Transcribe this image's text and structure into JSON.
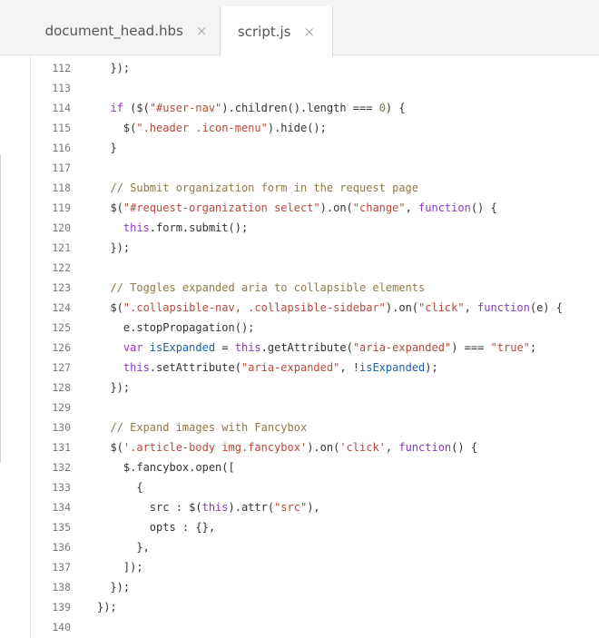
{
  "tabs": [
    {
      "label": "document_head.hbs",
      "close": "×",
      "active": false
    },
    {
      "label": "script.js",
      "close": "×",
      "active": true
    }
  ],
  "colors": {
    "keyword": "#8a3ab9",
    "string": "#b14a3a",
    "comment": "#8f7a4a",
    "number": "#6a8a3a",
    "variable": "#1f5fa0",
    "plain": "#333333"
  },
  "lines": [
    {
      "n": "112",
      "tokens": [
        {
          "t": "p",
          "s": "  });"
        }
      ]
    },
    {
      "n": "113",
      "tokens": []
    },
    {
      "n": "114",
      "tokens": [
        {
          "t": "kw",
          "s": "  if"
        },
        {
          "t": "p",
          "s": " ($("
        },
        {
          "t": "str",
          "s": "\"#user-nav\""
        },
        {
          "t": "p",
          "s": ").children().length === "
        },
        {
          "t": "num",
          "s": "0"
        },
        {
          "t": "p",
          "s": ") {"
        }
      ]
    },
    {
      "n": "115",
      "tokens": [
        {
          "t": "p",
          "s": "    $("
        },
        {
          "t": "str",
          "s": "\".header .icon-menu\""
        },
        {
          "t": "p",
          "s": ").hide();"
        }
      ]
    },
    {
      "n": "116",
      "tokens": [
        {
          "t": "p",
          "s": "  }"
        }
      ]
    },
    {
      "n": "117",
      "tokens": []
    },
    {
      "n": "118",
      "tokens": [
        {
          "t": "cm",
          "s": "  // Submit organization form in the request page"
        }
      ]
    },
    {
      "n": "119",
      "tokens": [
        {
          "t": "p",
          "s": "  $("
        },
        {
          "t": "str",
          "s": "\"#request-organization select\""
        },
        {
          "t": "p",
          "s": ").on("
        },
        {
          "t": "str",
          "s": "\"change\""
        },
        {
          "t": "p",
          "s": ", "
        },
        {
          "t": "kw",
          "s": "function"
        },
        {
          "t": "p",
          "s": "() {"
        }
      ]
    },
    {
      "n": "120",
      "tokens": [
        {
          "t": "kw",
          "s": "    this"
        },
        {
          "t": "p",
          "s": ".form.submit();"
        }
      ]
    },
    {
      "n": "121",
      "tokens": [
        {
          "t": "p",
          "s": "  });"
        }
      ]
    },
    {
      "n": "122",
      "tokens": []
    },
    {
      "n": "123",
      "tokens": [
        {
          "t": "cm",
          "s": "  // Toggles expanded aria to collapsible elements"
        }
      ]
    },
    {
      "n": "124",
      "tokens": [
        {
          "t": "p",
          "s": "  $("
        },
        {
          "t": "str",
          "s": "\".collapsible-nav, .collapsible-sidebar\""
        },
        {
          "t": "p",
          "s": ").on("
        },
        {
          "t": "str",
          "s": "\"click\""
        },
        {
          "t": "p",
          "s": ", "
        },
        {
          "t": "kw",
          "s": "function"
        },
        {
          "t": "p",
          "s": "(e) {"
        }
      ]
    },
    {
      "n": "125",
      "tokens": [
        {
          "t": "p",
          "s": "    e.stopPropagation();"
        }
      ]
    },
    {
      "n": "126",
      "tokens": [
        {
          "t": "kw",
          "s": "    var"
        },
        {
          "t": "p",
          "s": " "
        },
        {
          "t": "var",
          "s": "isExpanded"
        },
        {
          "t": "p",
          "s": " = "
        },
        {
          "t": "kw",
          "s": "this"
        },
        {
          "t": "p",
          "s": ".getAttribute("
        },
        {
          "t": "str",
          "s": "\"aria-expanded\""
        },
        {
          "t": "p",
          "s": ") === "
        },
        {
          "t": "str",
          "s": "\"true\""
        },
        {
          "t": "p",
          "s": ";"
        }
      ]
    },
    {
      "n": "127",
      "tokens": [
        {
          "t": "kw",
          "s": "    this"
        },
        {
          "t": "p",
          "s": ".setAttribute("
        },
        {
          "t": "str",
          "s": "\"aria-expanded\""
        },
        {
          "t": "p",
          "s": ", !"
        },
        {
          "t": "var",
          "s": "isExpanded"
        },
        {
          "t": "p",
          "s": ");"
        }
      ]
    },
    {
      "n": "128",
      "tokens": [
        {
          "t": "p",
          "s": "  });"
        }
      ]
    },
    {
      "n": "129",
      "tokens": []
    },
    {
      "n": "130",
      "tokens": [
        {
          "t": "cm",
          "s": "  // Expand images with Fancybox"
        }
      ]
    },
    {
      "n": "131",
      "tokens": [
        {
          "t": "p",
          "s": "  $("
        },
        {
          "t": "str",
          "s": "'.article-body img.fancybox'"
        },
        {
          "t": "p",
          "s": ").on("
        },
        {
          "t": "str",
          "s": "'click'"
        },
        {
          "t": "p",
          "s": ", "
        },
        {
          "t": "kw",
          "s": "function"
        },
        {
          "t": "p",
          "s": "() {"
        }
      ]
    },
    {
      "n": "132",
      "tokens": [
        {
          "t": "p",
          "s": "    $.fancybox.open(["
        }
      ]
    },
    {
      "n": "133",
      "tokens": [
        {
          "t": "p",
          "s": "      {"
        }
      ]
    },
    {
      "n": "134",
      "tokens": [
        {
          "t": "p",
          "s": "        src : $("
        },
        {
          "t": "kw",
          "s": "this"
        },
        {
          "t": "p",
          "s": ").attr("
        },
        {
          "t": "str",
          "s": "\"src\""
        },
        {
          "t": "p",
          "s": "),"
        }
      ]
    },
    {
      "n": "135",
      "tokens": [
        {
          "t": "p",
          "s": "        opts : {},"
        }
      ]
    },
    {
      "n": "136",
      "tokens": [
        {
          "t": "p",
          "s": "      },"
        }
      ]
    },
    {
      "n": "137",
      "tokens": [
        {
          "t": "p",
          "s": "    ]);"
        }
      ]
    },
    {
      "n": "138",
      "tokens": [
        {
          "t": "p",
          "s": "  });"
        }
      ]
    },
    {
      "n": "139",
      "tokens": [
        {
          "t": "p",
          "s": "});"
        }
      ]
    },
    {
      "n": "140",
      "tokens": []
    }
  ]
}
